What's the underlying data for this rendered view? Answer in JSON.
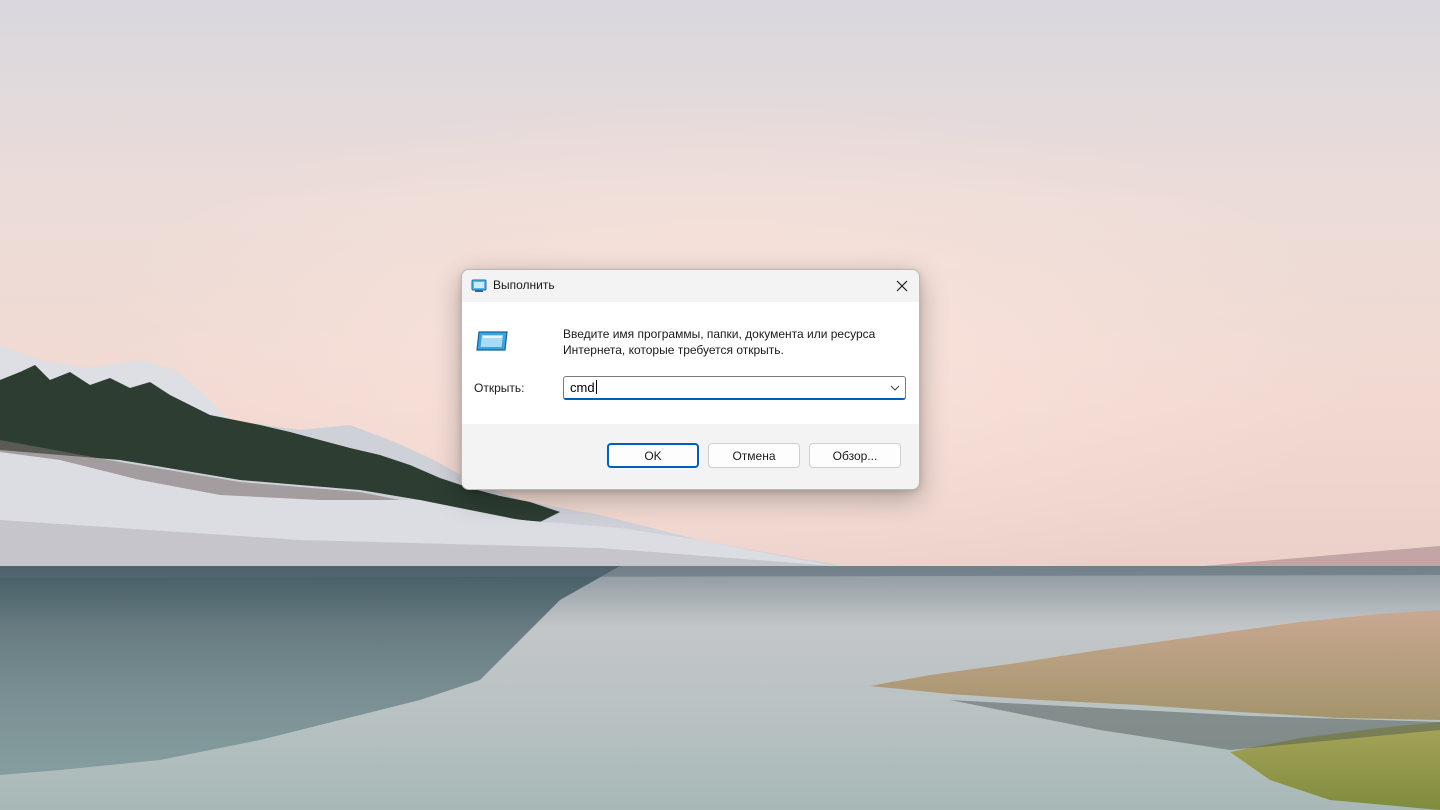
{
  "dialog": {
    "title": "Выполнить",
    "description": "Введите имя программы, папки, документа или ресурса Интернета, которые требуется открыть.",
    "open_label": "Открыть:",
    "open_value": "cmd",
    "ok_label": "OK",
    "cancel_label": "Отмена",
    "browse_label": "Обзор..."
  },
  "icons": {
    "title_icon": "run-icon",
    "big_icon": "run-icon",
    "close": "close-icon",
    "dropdown": "chevron-down-icon"
  },
  "colors": {
    "accent": "#005fb8",
    "dialog_bg": "#f3f3f3",
    "content_bg": "#ffffff"
  }
}
